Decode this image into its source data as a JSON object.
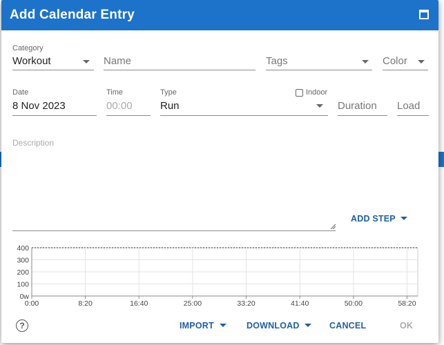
{
  "dialog": {
    "title": "Add Calendar Entry",
    "maximize_icon": "maximize-icon"
  },
  "form": {
    "category": {
      "label": "Category",
      "value": "Workout"
    },
    "name": {
      "placeholder": "Name"
    },
    "tags": {
      "placeholder": "Tags"
    },
    "color": {
      "placeholder": "Color"
    },
    "date": {
      "label": "Date",
      "value": "8 Nov 2023"
    },
    "time": {
      "label": "Time",
      "placeholder": "00:00"
    },
    "type": {
      "label": "Type",
      "value": "Run"
    },
    "indoor": {
      "label": "Indoor",
      "checked": false
    },
    "duration": {
      "placeholder": "Duration"
    },
    "load": {
      "placeholder": "Load"
    },
    "description": {
      "label": "Description"
    }
  },
  "add_step_label": "ADD STEP",
  "chart_data": {
    "type": "line",
    "x_ticks": [
      "0:00",
      "8:20",
      "16:40",
      "25:00",
      "33:20",
      "41:40",
      "50:00",
      "58:20"
    ],
    "x_tick_seconds": [
      0,
      500,
      1000,
      1500,
      2000,
      2500,
      3000,
      3500
    ],
    "xlim": [
      0,
      3600
    ],
    "y_ticks": [
      "0w",
      "100",
      "200",
      "300",
      "400"
    ],
    "y_tick_values": [
      0,
      100,
      200,
      300,
      400
    ],
    "ylim": [
      0,
      400
    ],
    "series": [],
    "grid": true,
    "top_line_style": "dotted"
  },
  "footer": {
    "help_icon": "help-icon",
    "import_label": "IMPORT",
    "download_label": "DOWNLOAD",
    "cancel_label": "CANCEL",
    "ok_label": "OK"
  },
  "colors": {
    "titlebar": "#1d73c9",
    "button_text": "#1d5fa8",
    "disabled_text": "#aaaaaa"
  }
}
